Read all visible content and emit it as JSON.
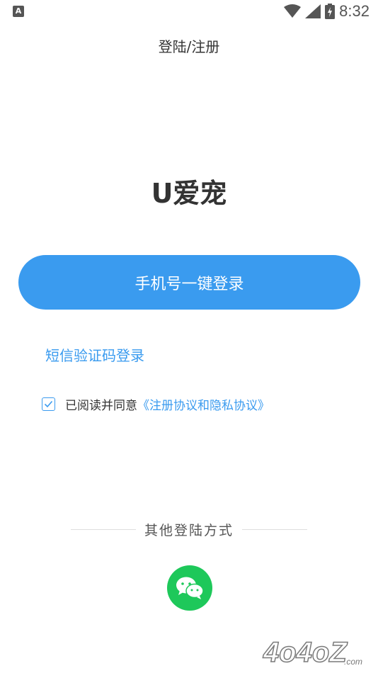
{
  "status_bar": {
    "time": "8:32",
    "left_icon": "A"
  },
  "header": {
    "title": "登陆/注册"
  },
  "app": {
    "name": "U爱宠"
  },
  "login": {
    "one_click_label": "手机号一键登录",
    "sms_label": "短信验证码登录"
  },
  "agreement": {
    "checked": true,
    "text": "已阅读并同意",
    "link": "《注册协议和隐私协议》"
  },
  "other": {
    "label": "其他登陆方式",
    "icons": [
      "wechat-icon"
    ]
  },
  "watermark": {
    "text": "4o4oZ",
    "suffix": ".com"
  },
  "colors": {
    "accent": "#3a9bef",
    "wechat": "#1ec85a",
    "text": "#333333"
  }
}
